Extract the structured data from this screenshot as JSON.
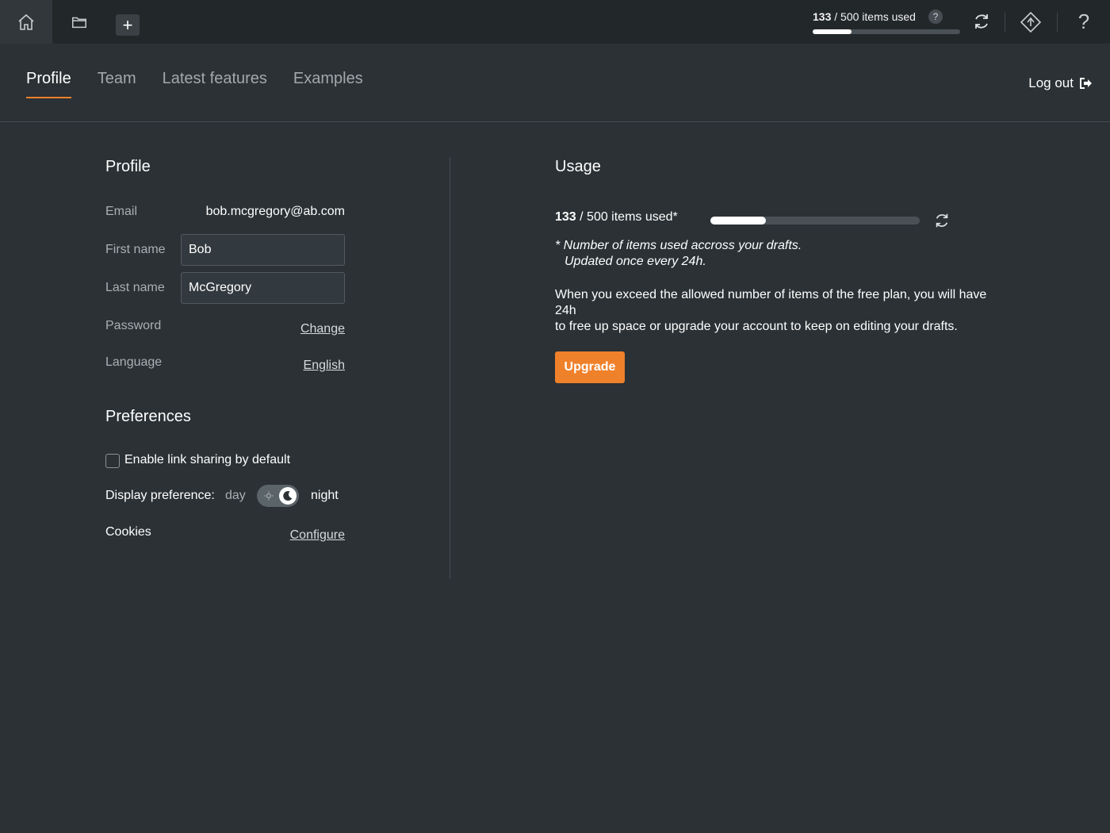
{
  "topbar": {
    "home_icon": "home-icon",
    "folder_icon": "folder-icon",
    "add_label": "+",
    "usage": {
      "used": "133",
      "separator": " / 500 items used",
      "fill": 0.266
    },
    "help_badge": "?",
    "help_label": "?"
  },
  "tabs": [
    {
      "label": "Profile",
      "active": true
    },
    {
      "label": "Team"
    },
    {
      "label": "Latest features"
    },
    {
      "label": "Examples"
    }
  ],
  "logout_label": "Log out",
  "profile": {
    "title": "Profile",
    "email_label": "Email",
    "email_value": "bob.mcgregory@ab.com",
    "first_name_label": "First name",
    "first_name_value": "Bob",
    "last_name_label": "Last name",
    "last_name_value": "McGregory",
    "password_label": "Password",
    "password_action": "Change",
    "language_label": "Language",
    "language_value": "English"
  },
  "preferences": {
    "title": "Preferences",
    "link_sharing_label": "Enable link sharing by default",
    "link_sharing_checked": false,
    "display_label": "Display preference:",
    "day_label": "day",
    "night_label": "night",
    "display_mode": "night",
    "cookies_label": "Cookies",
    "cookies_action": "Configure"
  },
  "usage": {
    "title": "Usage",
    "used": "133",
    "rest": " / 500 items used*",
    "fill": 0.266,
    "note_line1": "* Number of items used accross your drafts.",
    "note_line2": "Updated once every 24h.",
    "para_line1": "When you exceed the allowed number of items of the free plan, you will have 24h",
    "para_line2": "to free up space or upgrade your account to keep on editing your drafts.",
    "upgrade_label": "Upgrade"
  },
  "colors": {
    "background": "#2b3135",
    "topbar": "#22272a",
    "accent": "#f0812b"
  }
}
